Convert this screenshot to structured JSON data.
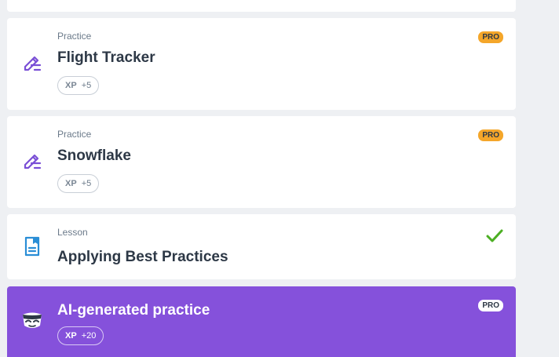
{
  "items": [
    {
      "type": "Practice",
      "title": "Flight Tracker",
      "xp_label": "XP",
      "xp_value": "+5",
      "badge": "PRO",
      "icon": "pencil-icon"
    },
    {
      "type": "Practice",
      "title": "Snowflake",
      "xp_label": "XP",
      "xp_value": "+5",
      "badge": "PRO",
      "icon": "pencil-icon"
    },
    {
      "type": "Lesson",
      "title": "Applying Best Practices",
      "status": "completed",
      "icon": "document-icon"
    },
    {
      "title": "AI-generated practice",
      "xp_label": "XP",
      "xp_value": "+20",
      "badge": "PRO",
      "icon": "ai-mascot-icon"
    }
  ],
  "colors": {
    "accent": "#8551db",
    "pro_badge": "#f4a62a",
    "check": "#4caf23",
    "icon_purple": "#7a4fd6",
    "icon_blue": "#2a8ed6"
  }
}
